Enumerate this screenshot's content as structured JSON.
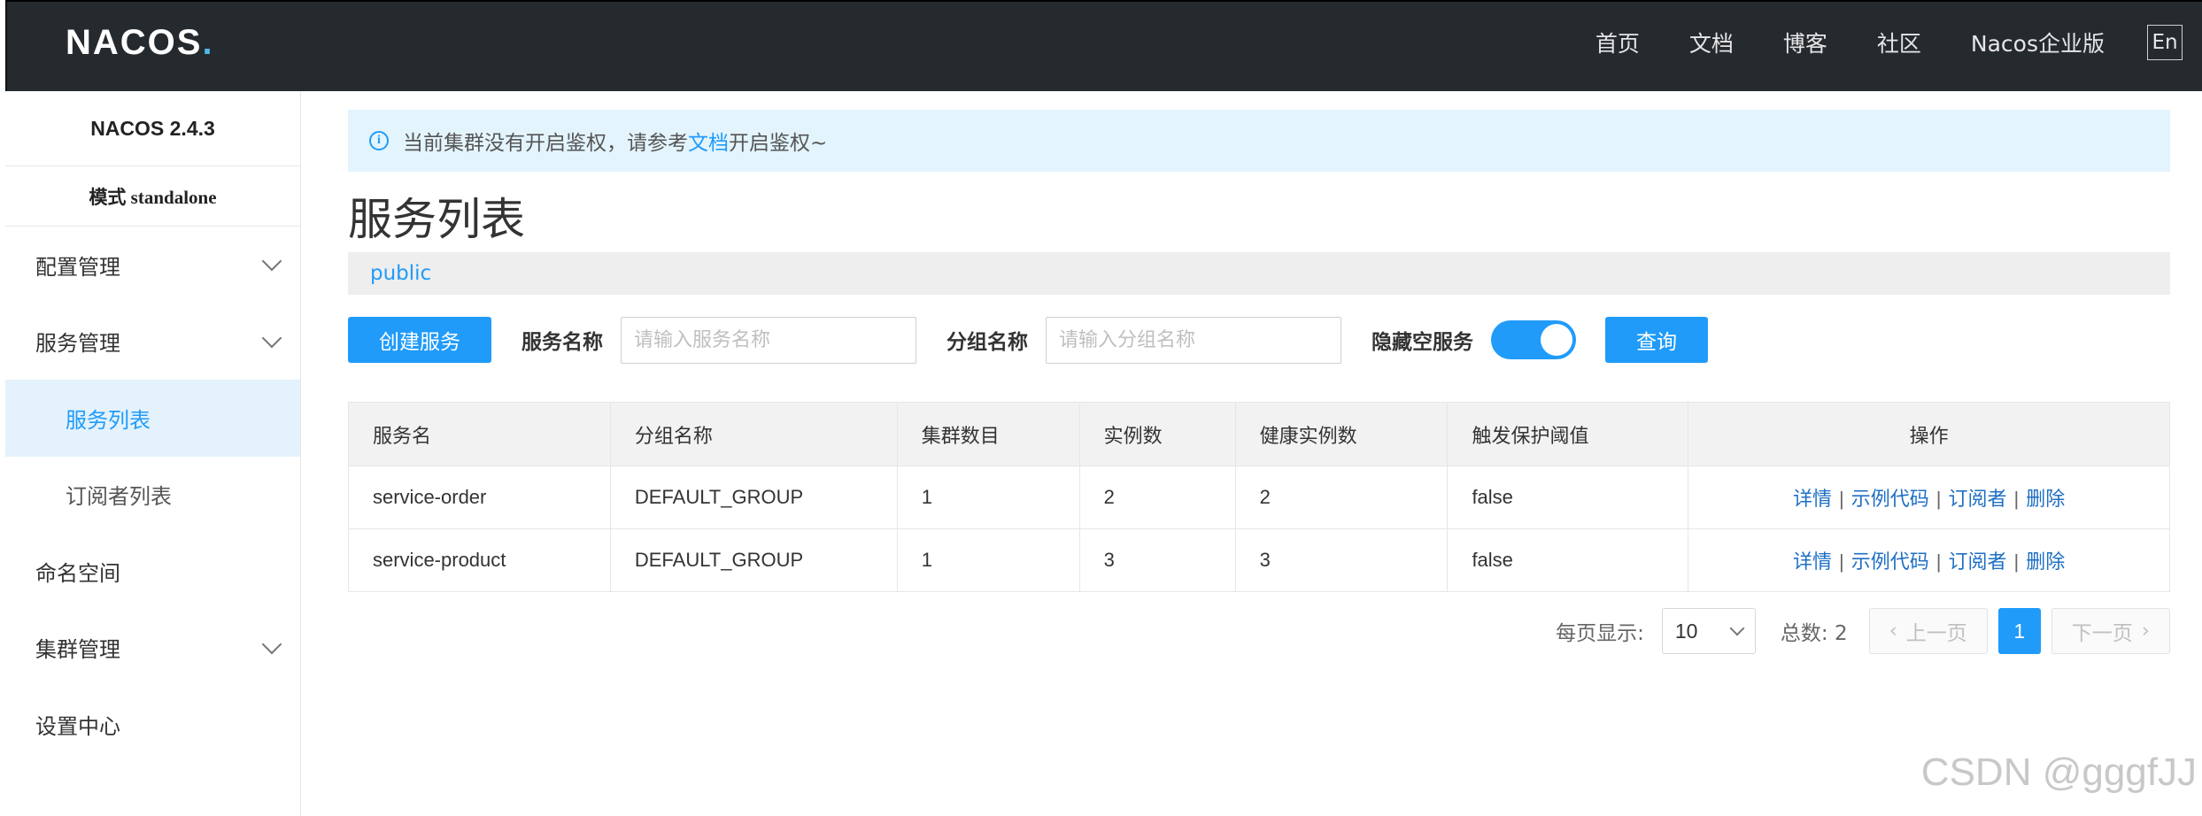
{
  "header": {
    "logo_text": "NACOS",
    "logo_dot": ".",
    "nav": [
      "首页",
      "文档",
      "博客",
      "社区",
      "Nacos企业版"
    ],
    "lang_button": "En"
  },
  "sidebar": {
    "version": "NACOS 2.4.3",
    "mode": "模式 standalone",
    "items": [
      {
        "label": "配置管理",
        "expandable": true
      },
      {
        "label": "服务管理",
        "expandable": true
      },
      {
        "label": "服务列表",
        "active": true
      },
      {
        "label": "订阅者列表"
      },
      {
        "label": "命名空间"
      },
      {
        "label": "集群管理",
        "expandable": true
      },
      {
        "label": "设置中心"
      }
    ]
  },
  "notice": {
    "icon": "i",
    "prefix": "当前集群没有开启鉴权，请参考",
    "link": "文档",
    "suffix": "开启鉴权~"
  },
  "page_title": "服务列表",
  "namespace": "public",
  "filters": {
    "create_button": "创建服务",
    "service_name_label": "服务名称",
    "service_name_placeholder": "请输入服务名称",
    "group_name_label": "分组名称",
    "group_name_placeholder": "请输入分组名称",
    "hide_empty_label": "隐藏空服务",
    "hide_empty_on": true,
    "query_button": "查询"
  },
  "table": {
    "headers": [
      "服务名",
      "分组名称",
      "集群数目",
      "实例数",
      "健康实例数",
      "触发保护阈值",
      "操作"
    ],
    "rows": [
      [
        "service-order",
        "DEFAULT_GROUP",
        "1",
        "2",
        "2",
        "false"
      ],
      [
        "service-product",
        "DEFAULT_GROUP",
        "1",
        "3",
        "3",
        "false"
      ]
    ],
    "actions": [
      "详情",
      "示例代码",
      "订阅者",
      "删除"
    ],
    "action_separator": "|"
  },
  "pagination": {
    "per_page_label": "每页显示:",
    "per_page_value": "10",
    "total_label": "总数: 2",
    "prev_label": "上一页",
    "current_page": "1",
    "next_label": "下一页"
  },
  "watermark": "CSDN @gggfJJ",
  "colors": {
    "accent": "#209bfa",
    "topbar": "#252a2f",
    "notice_bg": "#e3f4fd"
  }
}
